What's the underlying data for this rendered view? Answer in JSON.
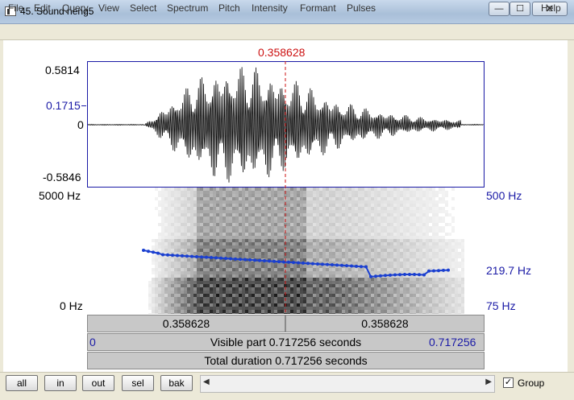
{
  "window": {
    "title": "45. Sound neng5",
    "minimize_glyph": "—",
    "maximize_glyph": "☐",
    "close_glyph": "✕"
  },
  "menu": [
    "File",
    "Edit",
    "Query",
    "View",
    "Select",
    "Spectrum",
    "Pitch",
    "Intensity",
    "Formant",
    "Pulses"
  ],
  "help": "Help",
  "cursor_time": "0.358628",
  "waveform": {
    "max_label": "0.5814",
    "cursor_amp_label": "0.1715",
    "zero_label": "0",
    "min_label": "-0.5846"
  },
  "spectrogram": {
    "freq_top": "5000 Hz",
    "freq_bottom": "0 Hz",
    "pitch_top": "500 Hz",
    "pitch_current": "219.7 Hz",
    "pitch_bottom": "75 Hz"
  },
  "segments": {
    "left": "0.358628",
    "right": "0.358628",
    "visible_start": "0",
    "visible_label": "Visible part 0.717256 seconds",
    "visible_end": "0.717256",
    "total_label": "Total duration 0.717256 seconds"
  },
  "buttons": {
    "all": "all",
    "in": "in",
    "out": "out",
    "sel": "sel",
    "bak": "bak"
  },
  "scroll": {
    "left_arrow": "◀",
    "right_arrow": "▶"
  },
  "group": {
    "label": "Group",
    "check": "✓"
  },
  "colors": {
    "cursor": "#cc1111",
    "pitch": "#1a3fd0",
    "label_blue": "#1a1aa6"
  }
}
